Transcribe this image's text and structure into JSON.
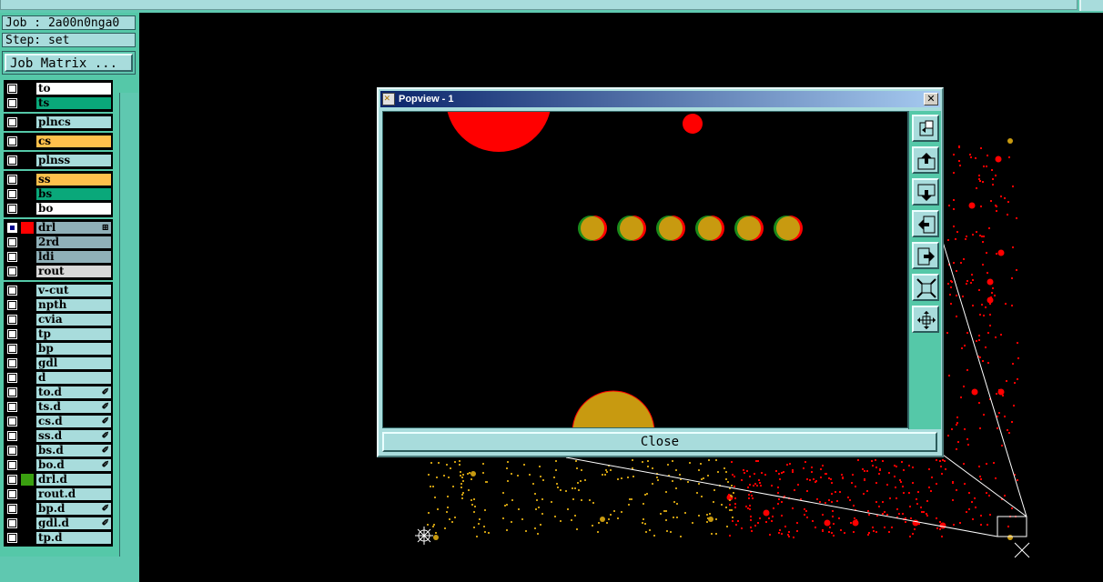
{
  "job_label": "Job : 2a00n0nga0",
  "step_label": "Step: set",
  "job_matrix_label": "Job Matrix ...",
  "layer_groups": [
    [
      {
        "name": "to",
        "color": "#ffffff"
      },
      {
        "name": "ts",
        "color": "#0aa87a"
      }
    ],
    [
      {
        "name": "plncs",
        "color": "#a8dcdc"
      }
    ],
    [
      {
        "name": "cs",
        "color": "#ffc04c"
      }
    ],
    [
      {
        "name": "plnss",
        "color": "#a8dcdc"
      }
    ],
    [
      {
        "name": "ss",
        "color": "#ffc04c"
      },
      {
        "name": "bs",
        "color": "#0aa87a"
      },
      {
        "name": "bo",
        "color": "#ffffff"
      }
    ],
    [
      {
        "name": "drl",
        "color": "#8fb0b8",
        "checked": true,
        "swatch": "#ff0000",
        "mark": "⊞"
      },
      {
        "name": "2rd",
        "color": "#8fb0b8"
      },
      {
        "name": "ldi",
        "color": "#8fb0b8"
      },
      {
        "name": "rout",
        "color": "#d8d8d8"
      }
    ],
    [
      {
        "name": "v-cut",
        "color": "#a8dcdc"
      },
      {
        "name": "npth",
        "color": "#a8dcdc"
      },
      {
        "name": "cvia",
        "color": "#a8dcdc"
      },
      {
        "name": "tp",
        "color": "#a8dcdc"
      },
      {
        "name": "bp",
        "color": "#a8dcdc"
      },
      {
        "name": "gdl",
        "color": "#a8dcdc"
      },
      {
        "name": "d",
        "color": "#a8dcdc"
      },
      {
        "name": "to.d",
        "color": "#a8dcdc",
        "mark": "✐"
      },
      {
        "name": "ts.d",
        "color": "#a8dcdc",
        "mark": "✐"
      },
      {
        "name": "cs.d",
        "color": "#a8dcdc",
        "mark": "✐"
      },
      {
        "name": "ss.d",
        "color": "#a8dcdc",
        "mark": "✐"
      },
      {
        "name": "bs.d",
        "color": "#a8dcdc",
        "mark": "✐"
      },
      {
        "name": "bo.d",
        "color": "#a8dcdc",
        "mark": "✐"
      },
      {
        "name": "drl.d",
        "color": "#a8dcdc",
        "swatch": "#3aa010"
      },
      {
        "name": "rout.d",
        "color": "#a8dcdc"
      },
      {
        "name": "bp.d",
        "color": "#a8dcdc",
        "mark": "✐"
      },
      {
        "name": "gdl.d",
        "color": "#a8dcdc",
        "mark": "✐"
      },
      {
        "name": "tp.d",
        "color": "#a8dcdc"
      }
    ]
  ],
  "popup": {
    "title": "Popview - 1",
    "close_button_label": "Close",
    "tools": [
      "zoom-fit-icon",
      "pan-up-icon",
      "pan-down-icon",
      "pan-left-icon",
      "pan-right-icon",
      "zoom-out-icon",
      "zoom-in-icon"
    ]
  },
  "colors": {
    "panel": "#55c8a8",
    "field": "#a8dcdc",
    "drill": "#ff0000",
    "pad": "#c89a10"
  }
}
